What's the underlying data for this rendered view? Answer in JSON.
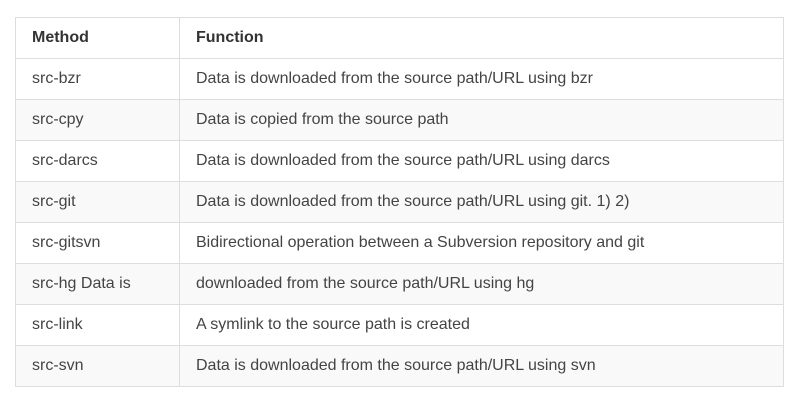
{
  "table": {
    "headers": [
      "Method",
      "Function"
    ],
    "rows": [
      [
        "src-bzr",
        "Data is downloaded from the source path/URL using bzr"
      ],
      [
        "src-cpy",
        "Data is copied from the source path"
      ],
      [
        "src-darcs",
        "Data is downloaded from the source path/URL using darcs"
      ],
      [
        "src-git",
        "Data is downloaded from the source path/URL using git. 1) 2)"
      ],
      [
        "src-gitsvn",
        "Bidirectional operation between a Subversion repository and git"
      ],
      [
        "src-hg Data is",
        "downloaded from the source path/URL using hg"
      ],
      [
        "src-link",
        "A symlink to the source path is created"
      ],
      [
        "src-svn",
        "Data is downloaded from the source path/URL using svn"
      ]
    ]
  }
}
